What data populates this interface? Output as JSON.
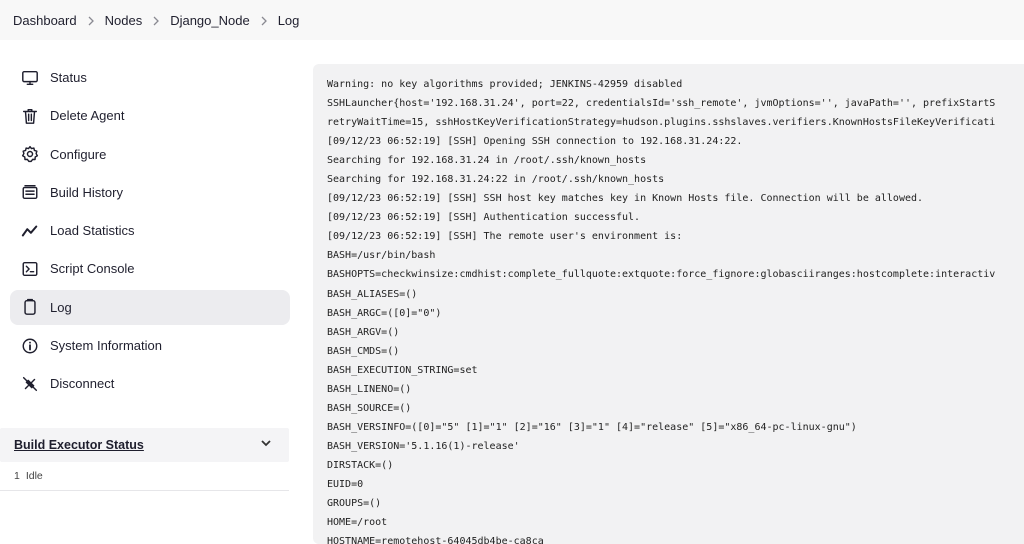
{
  "breadcrumb": {
    "items": [
      "Dashboard",
      "Nodes",
      "Django_Node",
      "Log"
    ]
  },
  "sidebar": {
    "items": [
      {
        "label": "Status",
        "icon": "monitor-icon"
      },
      {
        "label": "Delete Agent",
        "icon": "trash-icon"
      },
      {
        "label": "Configure",
        "icon": "gear-icon"
      },
      {
        "label": "Build History",
        "icon": "history-icon"
      },
      {
        "label": "Load Statistics",
        "icon": "trend-icon"
      },
      {
        "label": "Script Console",
        "icon": "terminal-icon"
      },
      {
        "label": "Log",
        "icon": "clipboard-icon",
        "active": true
      },
      {
        "label": "System Information",
        "icon": "info-icon"
      },
      {
        "label": "Disconnect",
        "icon": "disconnect-icon"
      }
    ]
  },
  "executor": {
    "title": "Build Executor Status",
    "rows": [
      {
        "num": "1",
        "state": "Idle"
      }
    ]
  },
  "log": {
    "lines": [
      "Warning: no key algorithms provided; JENKINS-42959 disabled",
      "SSHLauncher{host='192.168.31.24', port=22, credentialsId='ssh_remote', jvmOptions='', javaPath='', prefixStartS",
      "retryWaitTime=15, sshHostKeyVerificationStrategy=hudson.plugins.sshslaves.verifiers.KnownHostsFileKeyVerificati",
      "[09/12/23 06:52:19] [SSH] Opening SSH connection to 192.168.31.24:22.",
      "Searching for 192.168.31.24 in /root/.ssh/known_hosts",
      "Searching for 192.168.31.24:22 in /root/.ssh/known_hosts",
      "[09/12/23 06:52:19] [SSH] SSH host key matches key in Known Hosts file. Connection will be allowed.",
      "[09/12/23 06:52:19] [SSH] Authentication successful.",
      "[09/12/23 06:52:19] [SSH] The remote user's environment is:",
      "BASH=/usr/bin/bash",
      "BASHOPTS=checkwinsize:cmdhist:complete_fullquote:extquote:force_fignore:globasciiranges:hostcomplete:interactiv",
      "BASH_ALIASES=()",
      "BASH_ARGC=([0]=\"0\")",
      "BASH_ARGV=()",
      "BASH_CMDS=()",
      "BASH_EXECUTION_STRING=set",
      "BASH_LINENO=()",
      "BASH_SOURCE=()",
      "BASH_VERSINFO=([0]=\"5\" [1]=\"1\" [2]=\"16\" [3]=\"1\" [4]=\"release\" [5]=\"x86_64-pc-linux-gnu\")",
      "BASH_VERSION='5.1.16(1)-release'",
      "DIRSTACK=()",
      "EUID=0",
      "GROUPS=()",
      "HOME=/root",
      "HOSTNAME=remotehost-64045db4be-ca8ca"
    ]
  }
}
